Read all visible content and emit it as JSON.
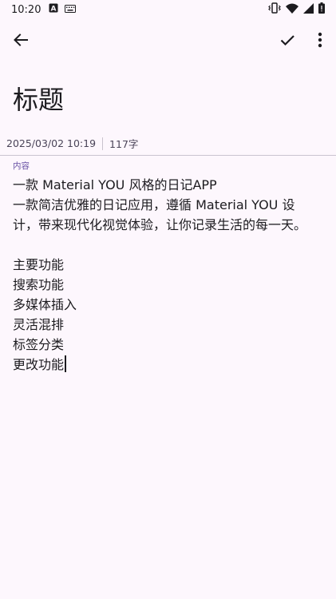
{
  "status_bar": {
    "time": "10:20",
    "left_icons": [
      "notification-a-icon",
      "keyboard-icon"
    ],
    "right_icons": [
      "vibrate-icon",
      "wifi-icon",
      "signal-icon",
      "battery-icon"
    ]
  },
  "app_bar": {
    "icons": [
      "arrow-back-icon",
      "check-icon",
      "more-vert-icon"
    ]
  },
  "note": {
    "title": "标题",
    "date": "2025/03/02 10:19",
    "word_count": "117字",
    "content_label": "内容",
    "paragraph_lines": [
      "一款 Material YOU 风格的日记APP",
      "一款简洁优雅的日记应用，遵循 Material YOU 设计，带来现代化视觉体验，让你记录生活的每一天。"
    ],
    "feature_lines": [
      "主要功能",
      "搜索功能",
      "多媒体插入",
      "灵活混排",
      "标签分类",
      "更改功能"
    ]
  },
  "colors": {
    "background": "#fdf7fd",
    "accent": "#6750a4",
    "text": "#1c1b1f",
    "divider": "#cac4d0"
  }
}
